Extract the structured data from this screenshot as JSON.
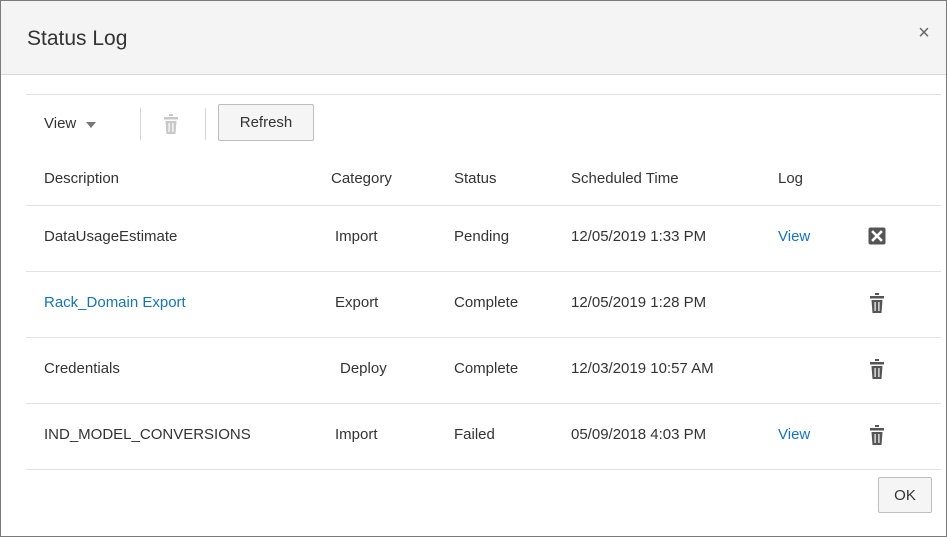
{
  "dialog": {
    "title": "Status Log",
    "close_glyph": "×",
    "ok_label": "OK"
  },
  "toolbar": {
    "view_label": "View",
    "delete_icon": "trash-icon",
    "refresh_label": "Refresh"
  },
  "table": {
    "headers": [
      "Description",
      "Category",
      "Status",
      "Scheduled Time",
      "Log"
    ],
    "rows": [
      {
        "description": "DataUsageEstimate",
        "category": "Import",
        "status": "Pending",
        "scheduled_time": "12/05/2019 1:33 PM",
        "log": "View",
        "description_is_link": false,
        "action_icon": "cancel-icon"
      },
      {
        "description": "Rack_Domain Export",
        "category": "Export",
        "status": "Complete",
        "scheduled_time": "12/05/2019 1:28 PM",
        "log": "",
        "description_is_link": true,
        "action_icon": "trash-icon"
      },
      {
        "description": "Credentials",
        "category": "Deploy",
        "status": "Complete",
        "scheduled_time": "12/03/2019 10:57 AM",
        "log": "",
        "description_is_link": false,
        "action_icon": "trash-icon"
      },
      {
        "description": "IND_MODEL_CONVERSIONS",
        "category": "Import",
        "status": "Failed",
        "scheduled_time": "05/09/2018 4:03 PM",
        "log": "View",
        "description_is_link": false,
        "action_icon": "trash-icon"
      }
    ]
  },
  "colors": {
    "link": "#1a73b5",
    "header_bg": "#f4f4f4",
    "icon": "#555555",
    "icon_disabled": "#c8c8c8"
  }
}
